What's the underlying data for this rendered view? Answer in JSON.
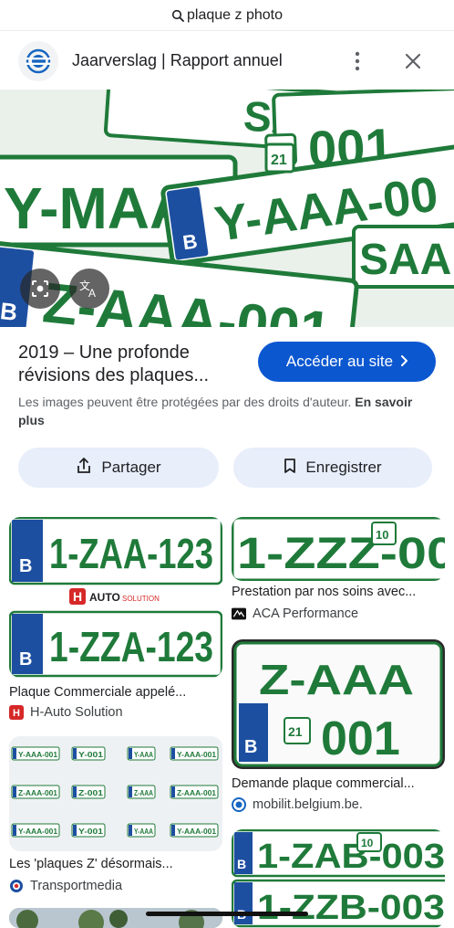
{
  "search": {
    "query": "plaque z photo"
  },
  "header": {
    "site_title": "Jaarverslag | Rapport annuel"
  },
  "hero": {
    "plates": [
      {
        "text": "SAA",
        "country": "B"
      },
      {
        "text": "Y-MAA",
        "country": "B"
      },
      {
        "text": "Y-AAA-00",
        "country": "B"
      },
      {
        "text": "Z-AAA-001",
        "country": "B"
      },
      {
        "text": "001",
        "country": "B"
      },
      {
        "text": "SAA",
        "country": "B"
      },
      {
        "text": "21",
        "country": "B"
      }
    ]
  },
  "result": {
    "title": "2019 – Une profonde révisions des plaques...",
    "visit_label": "Accéder au site",
    "copyright_text": "Les images peuvent être protégées par des droits d'auteur.",
    "copyright_link": "En savoir plus",
    "share_label": "Partager",
    "save_label": "Enregistrer"
  },
  "cards": [
    {
      "caption": "Plaque Commerciale appelé...",
      "source": "H-Auto Solution",
      "plate1": "1-ZAA-123",
      "plate2": "1-ZZA-123",
      "brand_mark": "H",
      "brand_name": "AUTO",
      "brand_sub": "SOLUTION",
      "country": "B"
    },
    {
      "caption": "Prestation par nos soins avec...",
      "source": "ACA Performance",
      "plate1": "1-ZZZ-00",
      "badge": "10",
      "country": "B"
    },
    {
      "caption": "Demande plaque commercial...",
      "source": "mobilit.belgium.be.",
      "plate_top": "Z-AAA",
      "plate_bottom": "001",
      "badge": "21",
      "country": "B"
    },
    {
      "caption": "Les 'plaques Z' désormais...",
      "source": "Transportmedia",
      "mini_plates": [
        "Y-AAA-001",
        "Y-001",
        "Y-AAA",
        "Y-AAA-001",
        "Z-AAA-001",
        "Z-001",
        "Z-AAA",
        "Z-AAA-001",
        "Y-AAA-001",
        "Y-001",
        "Y-AAA",
        "Y-AAA-001"
      ]
    },
    {
      "plate1": "1-ZAB-003",
      "plate2": "1-ZZB-003",
      "badge": "10",
      "country": "B"
    }
  ],
  "colors": {
    "plate_green": "#1f7a3a",
    "eu_blue": "#1d4fa1",
    "accent_blue": "#0b57d0",
    "chip_bg": "#e8eefa"
  },
  "icons": [
    "search-icon",
    "site-logo-icon",
    "more-vert-icon",
    "close-icon",
    "lens-icon",
    "translate-icon",
    "chevron-right-icon",
    "share-icon",
    "bookmark-icon"
  ]
}
